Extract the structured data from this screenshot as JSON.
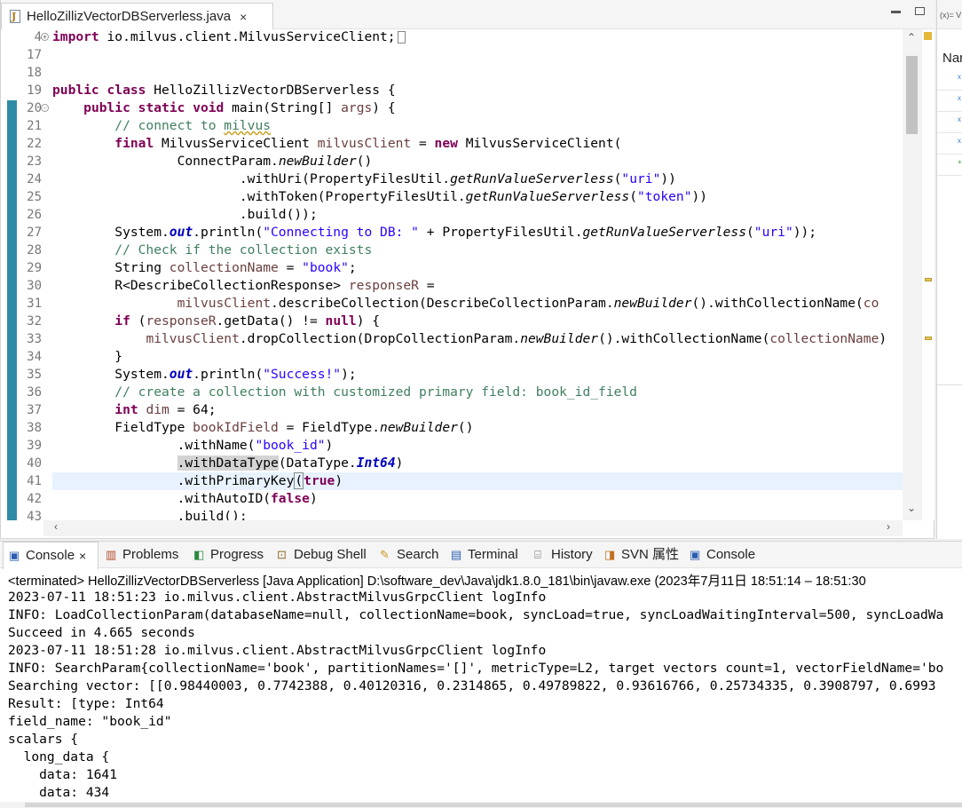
{
  "editor": {
    "tab_title": "HelloZillizVectorDBServerless.java",
    "tab_close": "×",
    "lines": [
      {
        "n": "4",
        "seg": [
          [
            "k",
            "import"
          ],
          [
            "p",
            " io.milvus.client.MilvusServiceClient;"
          ]
        ],
        "fold": "+",
        "box": true
      },
      {
        "n": "17",
        "seg": []
      },
      {
        "n": "18",
        "seg": []
      },
      {
        "n": "19",
        "seg": [
          [
            "k",
            "public"
          ],
          [
            "p",
            " "
          ],
          [
            "k",
            "class"
          ],
          [
            "p",
            " HelloZillizVectorDBServerless {"
          ]
        ]
      },
      {
        "n": "20",
        "seg": [
          [
            "p",
            "    "
          ],
          [
            "k",
            "public"
          ],
          [
            "p",
            " "
          ],
          [
            "k",
            "static"
          ],
          [
            "p",
            " "
          ],
          [
            "k",
            "void"
          ],
          [
            "p",
            " main(String[] "
          ],
          [
            "v",
            "args"
          ],
          [
            "p",
            ") {"
          ]
        ],
        "fold": "-"
      },
      {
        "n": "21",
        "seg": [
          [
            "c",
            "        // connect to "
          ],
          [
            "csq",
            "milvus"
          ]
        ]
      },
      {
        "n": "22",
        "seg": [
          [
            "p",
            "        "
          ],
          [
            "k",
            "final"
          ],
          [
            "p",
            " MilvusServiceClient "
          ],
          [
            "v",
            "milvusClient"
          ],
          [
            "p",
            " = "
          ],
          [
            "k",
            "new"
          ],
          [
            "p",
            " MilvusServiceClient("
          ]
        ]
      },
      {
        "n": "23",
        "seg": [
          [
            "p",
            "                ConnectParam."
          ],
          [
            "i",
            "newBuilder"
          ],
          [
            "p",
            "()"
          ]
        ]
      },
      {
        "n": "24",
        "seg": [
          [
            "p",
            "                        .withUri(PropertyFilesUtil."
          ],
          [
            "i",
            "getRunValueServerless"
          ],
          [
            "p",
            "("
          ],
          [
            "s",
            "\"uri\""
          ],
          [
            "p",
            "))"
          ]
        ]
      },
      {
        "n": "25",
        "seg": [
          [
            "p",
            "                        .withToken(PropertyFilesUtil."
          ],
          [
            "i",
            "getRunValueServerless"
          ],
          [
            "p",
            "("
          ],
          [
            "s",
            "\"token\""
          ],
          [
            "p",
            "))"
          ]
        ]
      },
      {
        "n": "26",
        "seg": [
          [
            "p",
            "                        .build());"
          ]
        ]
      },
      {
        "n": "27",
        "seg": [
          [
            "p",
            "        System."
          ],
          [
            "st",
            "out"
          ],
          [
            "p",
            ".println("
          ],
          [
            "s",
            "\"Connecting to DB: \""
          ],
          [
            "p",
            " + PropertyFilesUtil."
          ],
          [
            "i",
            "getRunValueServerless"
          ],
          [
            "p",
            "("
          ],
          [
            "s",
            "\"uri\""
          ],
          [
            "p",
            "));"
          ]
        ]
      },
      {
        "n": "28",
        "seg": [
          [
            "c",
            "        // Check if the collection exists"
          ]
        ]
      },
      {
        "n": "29",
        "seg": [
          [
            "p",
            "        String "
          ],
          [
            "v",
            "collectionName"
          ],
          [
            "p",
            " = "
          ],
          [
            "s",
            "\"book\""
          ],
          [
            "p",
            ";"
          ]
        ]
      },
      {
        "n": "30",
        "seg": [
          [
            "p",
            "        R<DescribeCollectionResponse> "
          ],
          [
            "v",
            "responseR"
          ],
          [
            "p",
            " ="
          ]
        ]
      },
      {
        "n": "31",
        "seg": [
          [
            "p",
            "                "
          ],
          [
            "v",
            "milvusClient"
          ],
          [
            "p",
            ".describeCollection(DescribeCollectionParam."
          ],
          [
            "i",
            "newBuilder"
          ],
          [
            "p",
            "().withCollectionName("
          ],
          [
            "v",
            "co"
          ]
        ]
      },
      {
        "n": "32",
        "seg": [
          [
            "p",
            "        "
          ],
          [
            "k",
            "if"
          ],
          [
            "p",
            " ("
          ],
          [
            "v",
            "responseR"
          ],
          [
            "p",
            ".getData() != "
          ],
          [
            "k",
            "null"
          ],
          [
            "p",
            ") {"
          ]
        ]
      },
      {
        "n": "33",
        "seg": [
          [
            "p",
            "            "
          ],
          [
            "v",
            "milvusClient"
          ],
          [
            "p",
            ".dropCollection(DropCollectionParam."
          ],
          [
            "i",
            "newBuilder"
          ],
          [
            "p",
            "().withCollectionName("
          ],
          [
            "v",
            "collectionName"
          ],
          [
            "p",
            ")"
          ]
        ]
      },
      {
        "n": "34",
        "seg": [
          [
            "p",
            "        }"
          ]
        ]
      },
      {
        "n": "35",
        "seg": [
          [
            "p",
            "        System."
          ],
          [
            "st",
            "out"
          ],
          [
            "p",
            ".println("
          ],
          [
            "s",
            "\"Success!\""
          ],
          [
            "p",
            ");"
          ]
        ]
      },
      {
        "n": "36",
        "seg": [
          [
            "c",
            "        // create a collection with customized primary field: book_id_field"
          ]
        ]
      },
      {
        "n": "37",
        "seg": [
          [
            "p",
            "        "
          ],
          [
            "k",
            "int"
          ],
          [
            "p",
            " "
          ],
          [
            "v",
            "dim"
          ],
          [
            "p",
            " = 64;"
          ]
        ]
      },
      {
        "n": "38",
        "seg": [
          [
            "p",
            "        FieldType "
          ],
          [
            "v",
            "bookIdField"
          ],
          [
            "p",
            " = FieldType."
          ],
          [
            "i",
            "newBuilder"
          ],
          [
            "p",
            "()"
          ]
        ]
      },
      {
        "n": "39",
        "seg": [
          [
            "p",
            "                .withName("
          ],
          [
            "s",
            "\"book_id\""
          ],
          [
            "p",
            ")"
          ]
        ]
      },
      {
        "n": "40",
        "seg": [
          [
            "p",
            "                "
          ],
          [
            "occ",
            ".withDataType"
          ],
          [
            "p",
            "(DataType."
          ],
          [
            "st",
            "Int64"
          ],
          [
            "p",
            ")"
          ]
        ]
      },
      {
        "n": "41",
        "seg": [
          [
            "p",
            "                .withPrimaryKey"
          ],
          [
            "bx",
            "("
          ],
          [
            "k",
            "true"
          ],
          [
            "p",
            ")"
          ]
        ],
        "current": true
      },
      {
        "n": "42",
        "seg": [
          [
            "p",
            "                .withAutoID("
          ],
          [
            "k",
            "false"
          ],
          [
            "p",
            ")"
          ]
        ]
      },
      {
        "n": "43",
        "seg": [
          [
            "p",
            "                .build();"
          ]
        ]
      }
    ]
  },
  "right_panel": {
    "tab_label": "(x)= V",
    "header": "Nar"
  },
  "console": {
    "tabs": [
      {
        "label": "Console",
        "icon": "console-icon",
        "active": true
      },
      {
        "label": "Problems",
        "icon": "problems-icon"
      },
      {
        "label": "Progress",
        "icon": "progress-icon"
      },
      {
        "label": "Debug Shell",
        "icon": "debug-shell-icon"
      },
      {
        "label": "Search",
        "icon": "search-icon"
      },
      {
        "label": "Terminal",
        "icon": "terminal-icon"
      },
      {
        "label": "History",
        "icon": "history-icon"
      },
      {
        "label": "SVN 属性",
        "icon": "svn-icon"
      },
      {
        "label": "Console",
        "icon": "console-icon"
      }
    ],
    "status": "<terminated> HelloZillizVectorDBServerless [Java Application] D:\\software_dev\\Java\\jdk1.8.0_181\\bin\\javaw.exe  (2023年7月11日 18:51:14 – 18:51:30",
    "output": [
      "2023-07-11 18:51:23 io.milvus.client.AbstractMilvusGrpcClient logInfo",
      "INFO: LoadCollectionParam(databaseName=null, collectionName=book, syncLoad=true, syncLoadWaitingInterval=500, syncLoadWa",
      "Succeed in 4.665 seconds",
      "2023-07-11 18:51:28 io.milvus.client.AbstractMilvusGrpcClient logInfo",
      "INFO: SearchParam{collectionName='book', partitionNames='[]', metricType=L2, target vectors count=1, vectorFieldName='bo",
      "Searching vector: [[0.98440003, 0.7742388, 0.40120316, 0.2314865, 0.49789822, 0.93616766, 0.25734335, 0.3908797, 0.6993",
      "Result: [type: Int64",
      "field_name: \"book_id\"",
      "scalars {",
      "  long_data {",
      "    data: 1641",
      "    data: 434"
    ]
  }
}
